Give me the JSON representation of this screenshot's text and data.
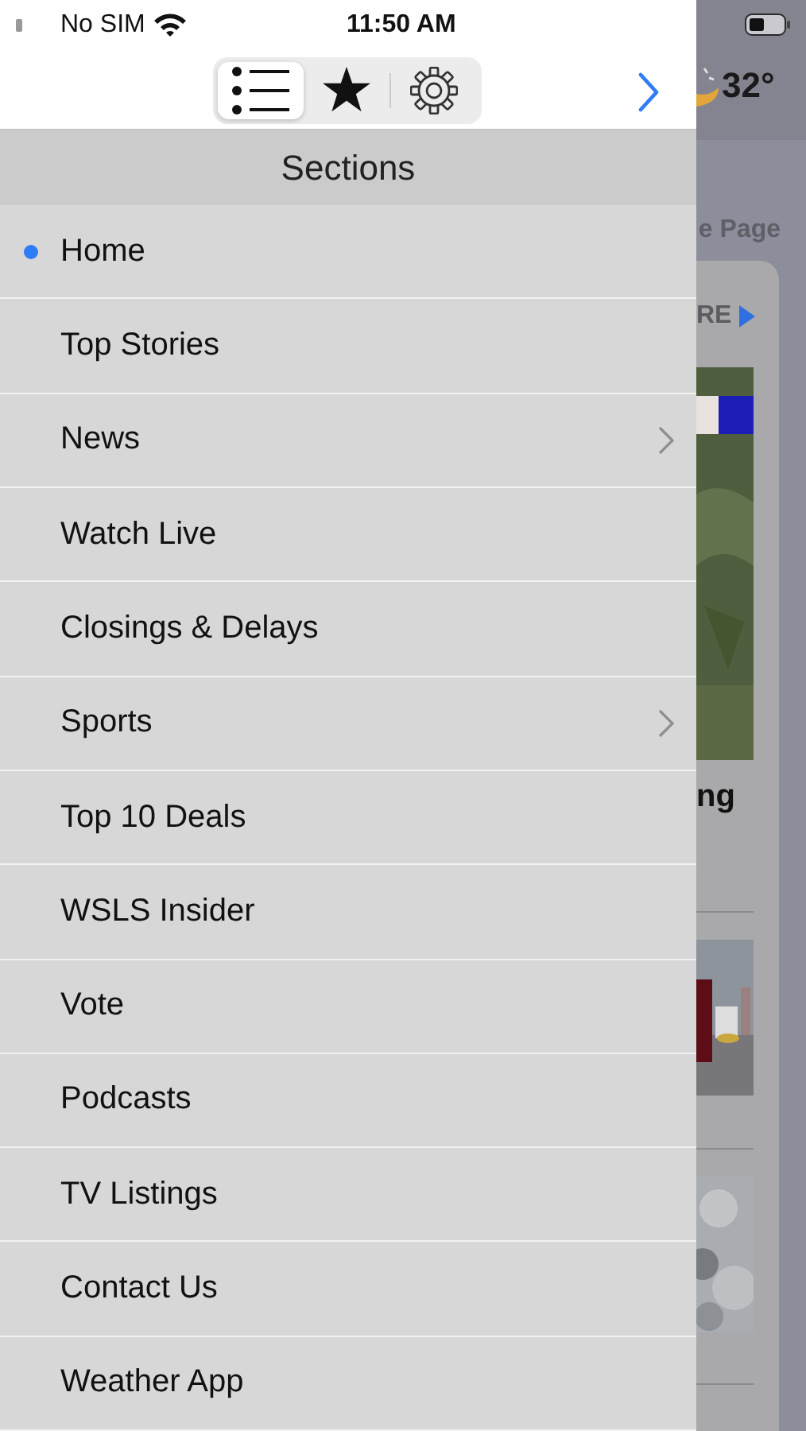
{
  "status_bar": {
    "carrier": "No SIM",
    "time": "11:50 AM"
  },
  "toolbar": {
    "segments": [
      {
        "kind": "list",
        "selected": true
      },
      {
        "kind": "star",
        "selected": false
      },
      {
        "kind": "gear",
        "selected": false
      }
    ]
  },
  "sections": {
    "title": "Sections",
    "items": [
      {
        "label": "Home",
        "selected": true,
        "has_children": false
      },
      {
        "label": "Top Stories",
        "selected": false,
        "has_children": false
      },
      {
        "label": "News",
        "selected": false,
        "has_children": true
      },
      {
        "label": "Watch Live",
        "selected": false,
        "has_children": false
      },
      {
        "label": "Closings & Delays",
        "selected": false,
        "has_children": false
      },
      {
        "label": "Sports",
        "selected": false,
        "has_children": true
      },
      {
        "label": "Top 10 Deals",
        "selected": false,
        "has_children": false
      },
      {
        "label": "WSLS Insider",
        "selected": false,
        "has_children": false
      },
      {
        "label": "Vote",
        "selected": false,
        "has_children": false
      },
      {
        "label": "Podcasts",
        "selected": false,
        "has_children": false
      },
      {
        "label": "TV Listings",
        "selected": false,
        "has_children": false
      },
      {
        "label": "Contact Us",
        "selected": false,
        "has_children": false
      },
      {
        "label": "Weather App",
        "selected": false,
        "has_children": false
      }
    ]
  },
  "background_page": {
    "temperature": "32°",
    "page_title": "e Page",
    "more_link": "RE",
    "headline": "ng"
  }
}
